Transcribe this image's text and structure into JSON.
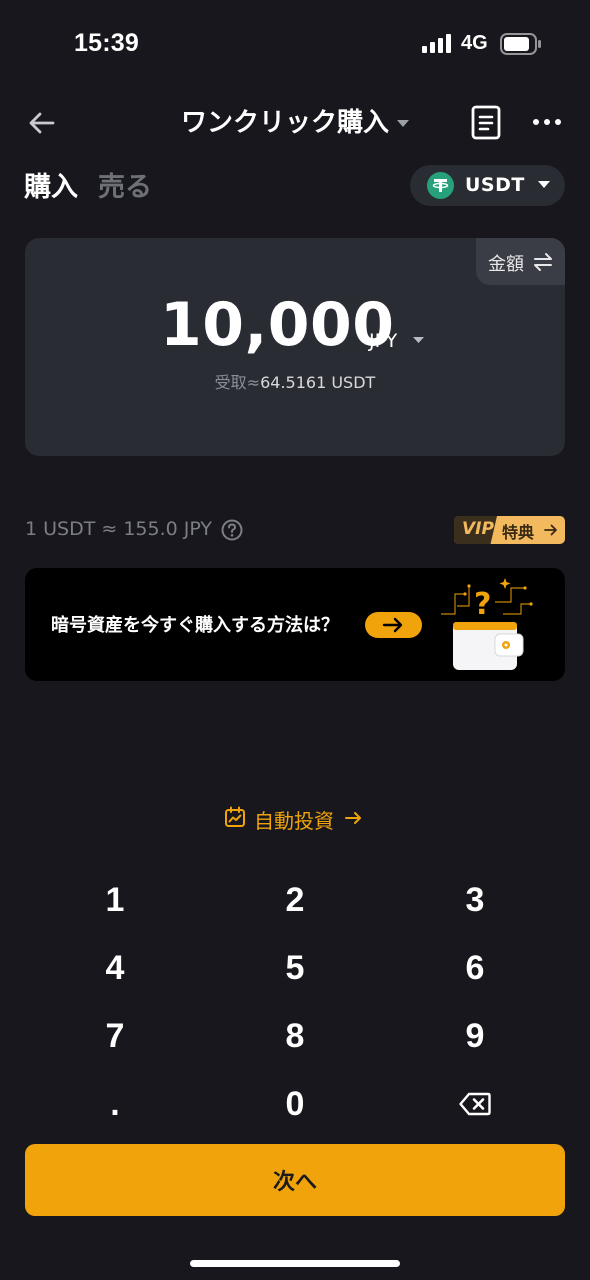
{
  "status_bar": {
    "time": "15:39",
    "network": "4G"
  },
  "nav": {
    "title": "ワンクリック購入"
  },
  "tabs": [
    {
      "label": "購入",
      "active": true
    },
    {
      "label": "売る",
      "active": false
    }
  ],
  "coin_select": {
    "symbol": "USDT",
    "icon": "tether-icon",
    "icon_color": "#26a17b"
  },
  "amount_card": {
    "toggle_label": "金額",
    "amount": "10,000",
    "currency": "JPY",
    "receive_prefix": "受取≈",
    "receive_value": "64.5161 USDT"
  },
  "rate": {
    "text": "1 USDT ≈ 155.0 JPY"
  },
  "vip": {
    "badge": "VIP",
    "label": "特典"
  },
  "promo": {
    "text": "暗号資産を今すぐ購入する方法は？"
  },
  "auto_invest": {
    "label": "自動投資"
  },
  "keypad": {
    "keys": [
      "1",
      "2",
      "3",
      "4",
      "5",
      "6",
      "7",
      "8",
      "9",
      ".",
      "0"
    ]
  },
  "next_button": {
    "label": "次へ"
  },
  "colors": {
    "accent": "#f0a30a",
    "background": "#17171d",
    "card": "#2a2c33"
  }
}
